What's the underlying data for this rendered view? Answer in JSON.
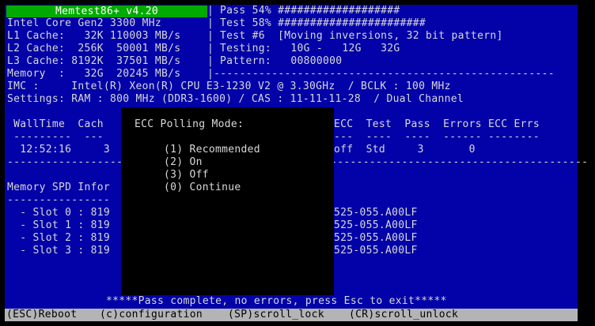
{
  "header": {
    "title": "Memtest86+ v4.20",
    "cpu": "Intel Core Gen2 3300 MHz",
    "l1": "L1 Cache:   32K 110003 MB/s",
    "l2": "L2 Cache:  256K  50001 MB/s",
    "l3": "L3 Cache: 8192K  37501 MB/s",
    "memory": "Memory  :   32G  20245 MB/s",
    "divider": "|",
    "pass_line": "Pass 54% ###################",
    "test_line": "Test 58% #######################",
    "test_name": "Test #6  [Moving inversions, 32 bit pattern]",
    "testing": "Testing:   10G -   12G   32G",
    "pattern": "Pattern:   00800000",
    "memory_rule": "|-----------------------------------------------------"
  },
  "imc_line": "IMC :     Intel(R) Xeon(R) CPU E3-1230 V2 @ 3.30GHz  / BCLK : 100 MHz",
  "settings_line": "Settings: RAM : 800 MHz (DDR3-1600) / CAS : 11-11-11-28  / Dual Channel",
  "table": {
    "header_left": " WallTime  Cach",
    "rule_left": " ---------  ---",
    "row_left": "  12:52:16     3",
    "header_right": "ECC  Test  Pass  Errors ECC Errs",
    "rule_right": "---  ----  ----  ------ --------",
    "row_right": "off  Std     3       0",
    "bottom_rule_left": "---------------------------------",
    "bottom_rule_right": "-----------------------------------------"
  },
  "spd": {
    "heading": "Memory SPD Infor",
    "rule": "----------------",
    "slots_left": [
      "  - Slot 0 : 819",
      "  - Slot 1 : 819",
      "  - Slot 2 : 819",
      "  - Slot 3 : 819"
    ],
    "slots_right": [
      "525-055.A00LF",
      "525-055.A00LF",
      "525-055.A00LF",
      "525-055.A00LF"
    ]
  },
  "popup": {
    "title": "ECC Polling Mode:",
    "options": [
      "(1) Recommended",
      "(2) On",
      "(3) Off",
      "(0) Continue"
    ]
  },
  "status_message": "*****Pass complete, no errors, press Esc to exit*****",
  "bottom_bar": {
    "reboot": "(ESC)Reboot",
    "config": "(c)configuration",
    "scroll_lock": "(SP)scroll_lock",
    "scroll_unlock": "(CR)scroll_unlock"
  },
  "colors": {
    "background": "#0202a8",
    "title_bar": "#00aa00",
    "popup": "#000000",
    "bottom_bar": "#b4b4b4"
  }
}
